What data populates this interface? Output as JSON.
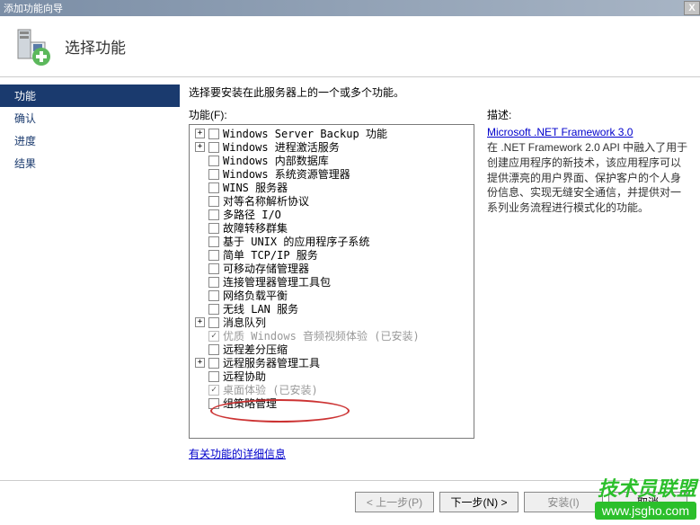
{
  "window": {
    "title": "添加功能向导",
    "close": "X"
  },
  "header": {
    "title": "选择功能"
  },
  "sidebar": {
    "items": [
      {
        "label": "功能",
        "active": true
      },
      {
        "label": "确认",
        "active": false
      },
      {
        "label": "进度",
        "active": false
      },
      {
        "label": "结果",
        "active": false
      }
    ]
  },
  "main": {
    "instruction": "选择要安装在此服务器上的一个或多个功能。",
    "features_label": "功能(F):",
    "features": [
      {
        "label": "Windows Server Backup 功能",
        "expandable": true,
        "checked": false,
        "disabled": false
      },
      {
        "label": "Windows 进程激活服务",
        "expandable": true,
        "checked": false,
        "disabled": false
      },
      {
        "label": "Windows 内部数据库",
        "expandable": false,
        "checked": false,
        "disabled": false
      },
      {
        "label": "Windows 系统资源管理器",
        "expandable": false,
        "checked": false,
        "disabled": false
      },
      {
        "label": "WINS 服务器",
        "expandable": false,
        "checked": false,
        "disabled": false
      },
      {
        "label": "对等名称解析协议",
        "expandable": false,
        "checked": false,
        "disabled": false
      },
      {
        "label": "多路径 I/O",
        "expandable": false,
        "checked": false,
        "disabled": false
      },
      {
        "label": "故障转移群集",
        "expandable": false,
        "checked": false,
        "disabled": false
      },
      {
        "label": "基于 UNIX 的应用程序子系统",
        "expandable": false,
        "checked": false,
        "disabled": false
      },
      {
        "label": "简单 TCP/IP 服务",
        "expandable": false,
        "checked": false,
        "disabled": false
      },
      {
        "label": "可移动存储管理器",
        "expandable": false,
        "checked": false,
        "disabled": false
      },
      {
        "label": "连接管理器管理工具包",
        "expandable": false,
        "checked": false,
        "disabled": false
      },
      {
        "label": "网络负载平衡",
        "expandable": false,
        "checked": false,
        "disabled": false
      },
      {
        "label": "无线 LAN 服务",
        "expandable": false,
        "checked": false,
        "disabled": false
      },
      {
        "label": "消息队列",
        "expandable": true,
        "checked": false,
        "disabled": false
      },
      {
        "label": "优质 Windows 音频视频体验",
        "suffix": " (已安装)",
        "expandable": false,
        "checked": true,
        "disabled": true
      },
      {
        "label": "远程差分压缩",
        "expandable": false,
        "checked": false,
        "disabled": false
      },
      {
        "label": "远程服务器管理工具",
        "expandable": true,
        "checked": false,
        "disabled": false
      },
      {
        "label": "远程协助",
        "expandable": false,
        "checked": false,
        "disabled": false
      },
      {
        "label": "桌面体验",
        "suffix": " (已安装)",
        "expandable": false,
        "checked": true,
        "disabled": true
      },
      {
        "label": "组策略管理",
        "expandable": false,
        "checked": false,
        "disabled": false
      }
    ],
    "more_link": "有关功能的详细信息"
  },
  "description": {
    "label": "描述:",
    "link_text": "Microsoft .NET Framework 3.0",
    "body": "在 .NET Framework 2.0 API 中融入了用于创建应用程序的新技术，该应用程序可以提供漂亮的用户界面、保护客户的个人身份信息、实现无缝安全通信，并提供对一系列业务流程进行模式化的功能。"
  },
  "footer": {
    "prev": "< 上一步(P)",
    "next": "下一步(N) >",
    "install": "安装(I)",
    "cancel": "取消"
  },
  "watermark": {
    "top": "技术员联盟",
    "url": "www.jsgho.com"
  }
}
